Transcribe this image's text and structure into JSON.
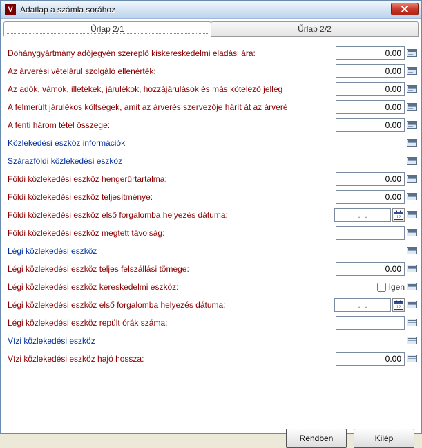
{
  "titlebar": {
    "title": "Adatlap  a számla sorához"
  },
  "tabs": {
    "active": "Űrlap 2/1",
    "inactive": "Űrlap 2/2"
  },
  "rows": [
    {
      "label": "Dohánygyártmány adójegyén szereplő kiskereskedelmi eladási ára:",
      "kind": "num",
      "value": "0.00",
      "color": "red"
    },
    {
      "label": "Az árverési vételárul szolgáló ellenérték:",
      "kind": "num",
      "value": "0.00",
      "color": "red"
    },
    {
      "label": "Az adók, vámok, illetékek, járulékok, hozzájárulások és más kötelező jelleg",
      "kind": "num",
      "value": "0.00",
      "color": "red"
    },
    {
      "label": "A felmerült járulékos költségek, amit az árverés szervezője hárít át az árveré",
      "kind": "num",
      "value": "0.00",
      "color": "red"
    },
    {
      "label": "A fenti három tétel összege:",
      "kind": "num",
      "value": "0.00",
      "color": "red"
    },
    {
      "label": "Közlekedési eszköz információk",
      "kind": "section",
      "color": "blu"
    },
    {
      "label": "Szárazföldi közlekedési eszköz",
      "kind": "section",
      "color": "blu"
    },
    {
      "label": "Földi közlekedési eszköz hengerűrtartalma:",
      "kind": "num",
      "value": "0.00",
      "color": "red"
    },
    {
      "label": "Földi közlekedési eszköz teljesítménye:",
      "kind": "num",
      "value": "0.00",
      "color": "red"
    },
    {
      "label": "Földi közlekedési eszköz első forgalomba helyezés dátuma:",
      "kind": "date",
      "value": ".  .",
      "color": "red"
    },
    {
      "label": "Földi közlekedési eszköz megtett távolság:",
      "kind": "text",
      "value": "",
      "color": "red"
    },
    {
      "label": "Légi közlekedési eszköz",
      "kind": "section",
      "color": "blu"
    },
    {
      "label": "Légi közlekedési eszköz teljes felszállási tömege:",
      "kind": "num",
      "value": "0.00",
      "color": "red"
    },
    {
      "label": "Légi közlekedési eszköz kereskedelmi eszköz:",
      "kind": "check",
      "checkLabel": "Igen",
      "color": "red"
    },
    {
      "label": "Légi közlekedési eszköz első forgalomba helyezés dátuma:",
      "kind": "date",
      "value": ".  .",
      "color": "red"
    },
    {
      "label": "Légi közlekedési eszköz repült órák száma:",
      "kind": "text",
      "value": "",
      "color": "red"
    },
    {
      "label": "Vízi közlekedési eszköz",
      "kind": "section",
      "color": "blu"
    },
    {
      "label": "Vízi közlekedési eszköz hajó hossza:",
      "kind": "num",
      "value": "0.00",
      "color": "red"
    }
  ],
  "footer": {
    "ok": "Rendben",
    "cancel": "Kilép"
  }
}
